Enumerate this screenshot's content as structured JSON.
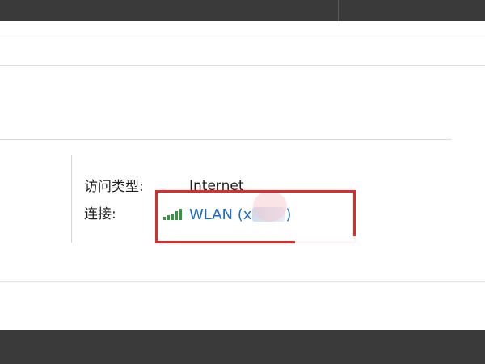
{
  "network_details": {
    "access_type_label": "访问类型:",
    "access_type_value": "Internet",
    "connections_label": "连接:",
    "connection": {
      "name_prefix": "WLAN (x",
      "name_suffix": ")",
      "icon": "wifi-signal-icon",
      "signal_bars": 5
    }
  },
  "colors": {
    "link": "#1f6cc4",
    "highlight_box": "#e02b2b",
    "wifi_signal": "#2e9a3e"
  }
}
